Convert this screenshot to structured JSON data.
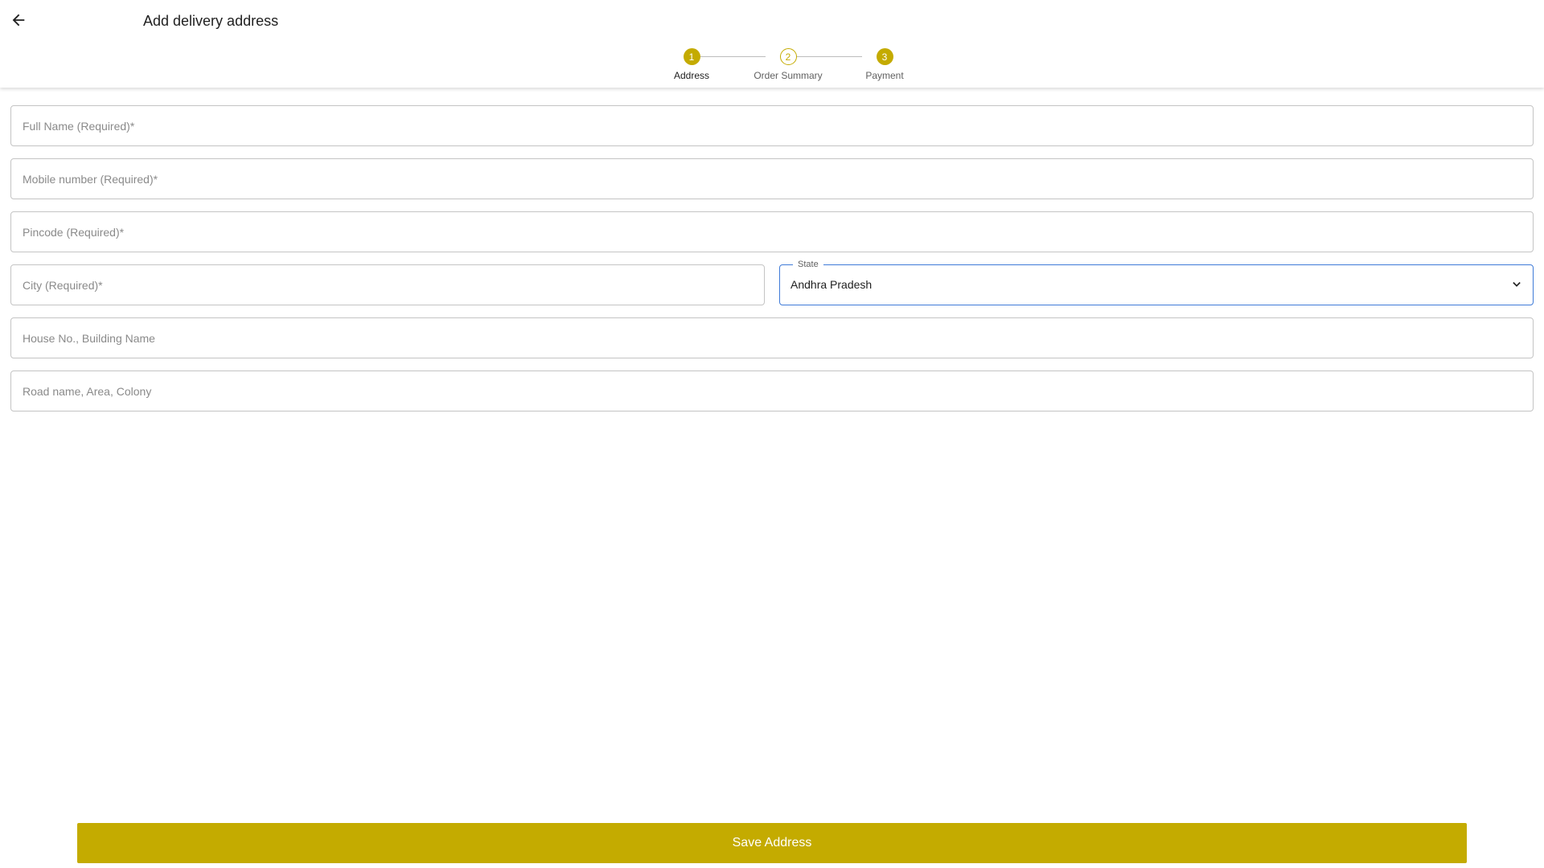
{
  "header": {
    "title": "Add delivery address",
    "back_icon": "arrow-left-icon"
  },
  "stepper": {
    "steps": [
      {
        "number": "1",
        "label": "Address",
        "state": "active"
      },
      {
        "number": "2",
        "label": "Order Summary",
        "state": "pending"
      },
      {
        "number": "3",
        "label": "Payment",
        "state": "completed-style"
      }
    ]
  },
  "form": {
    "full_name": {
      "placeholder": "Full Name (Required)*",
      "value": ""
    },
    "mobile": {
      "placeholder": "Mobile number (Required)*",
      "value": ""
    },
    "pincode": {
      "placeholder": "Pincode (Required)*",
      "value": ""
    },
    "city": {
      "placeholder": "City (Required)*",
      "value": ""
    },
    "state": {
      "label": "State",
      "value": "Andhra Pradesh",
      "icon": "chevron-down-icon"
    },
    "house": {
      "placeholder": "House No., Building Name",
      "value": ""
    },
    "road": {
      "placeholder": "Road name, Area, Colony",
      "value": ""
    }
  },
  "actions": {
    "save_label": "Save Address"
  },
  "colors": {
    "accent": "#c4ab00",
    "focus_border": "#3f7bd8",
    "border": "#c4c4c4"
  }
}
